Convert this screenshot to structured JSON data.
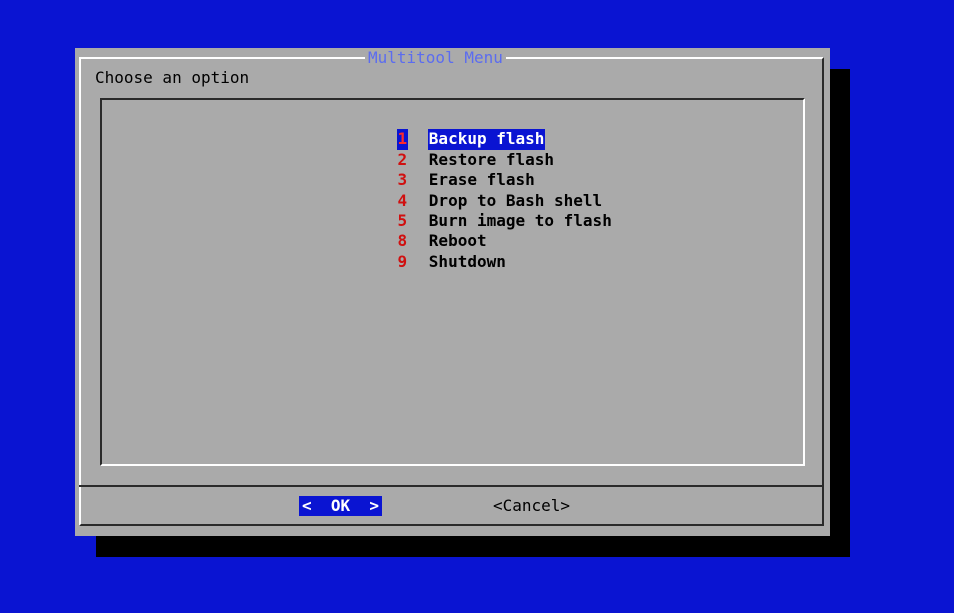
{
  "dialog": {
    "title": "Multitool Menu",
    "prompt": "Choose an option"
  },
  "menu": {
    "items": [
      {
        "tag": "1",
        "label": "Backup flash",
        "selected": true
      },
      {
        "tag": "2",
        "label": "Restore flash",
        "selected": false
      },
      {
        "tag": "3",
        "label": "Erase flash",
        "selected": false
      },
      {
        "tag": "4",
        "label": "Drop to Bash shell",
        "selected": false
      },
      {
        "tag": "5",
        "label": "Burn image to flash",
        "selected": false
      },
      {
        "tag": "8",
        "label": "Reboot",
        "selected": false
      },
      {
        "tag": "9",
        "label": "Shutdown",
        "selected": false
      }
    ]
  },
  "buttons": {
    "ok_label": "<  OK  >",
    "cancel_label": "<Cancel>"
  },
  "colors": {
    "background": "#0a14d2",
    "dialog": "#aaaaaa",
    "title": "#5b6cf0",
    "tag": "#d01010",
    "highlight": "#0a14d2"
  }
}
